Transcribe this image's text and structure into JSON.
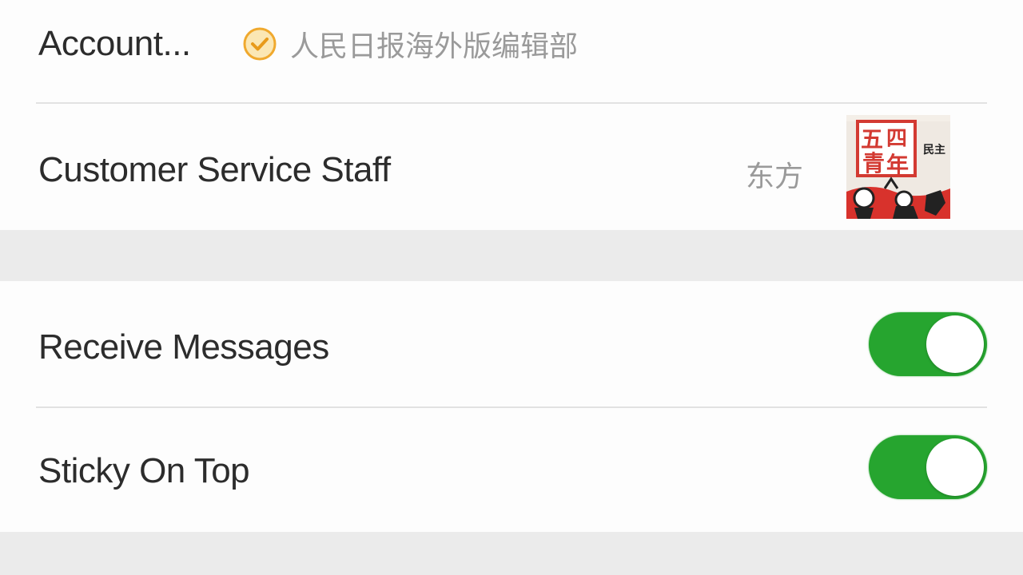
{
  "account_info": {
    "label": "Account...",
    "verified_icon": "checkmark-circle-icon",
    "verified_color": "#f0a92e",
    "verified_name": "人民日报海外版编辑部"
  },
  "customer_service": {
    "label": "Customer Service Staff",
    "staff_name": "东方",
    "avatar_glyphs": [
      "五",
      "四",
      "青",
      "年",
      "民主"
    ]
  },
  "settings": {
    "receive_messages": {
      "label": "Receive Messages",
      "enabled": true
    },
    "sticky_on_top": {
      "label": "Sticky On Top",
      "enabled": true
    }
  },
  "colors": {
    "toggle_on": "#26a52f",
    "background": "#ebebeb",
    "row_background": "#fdfdfd"
  }
}
